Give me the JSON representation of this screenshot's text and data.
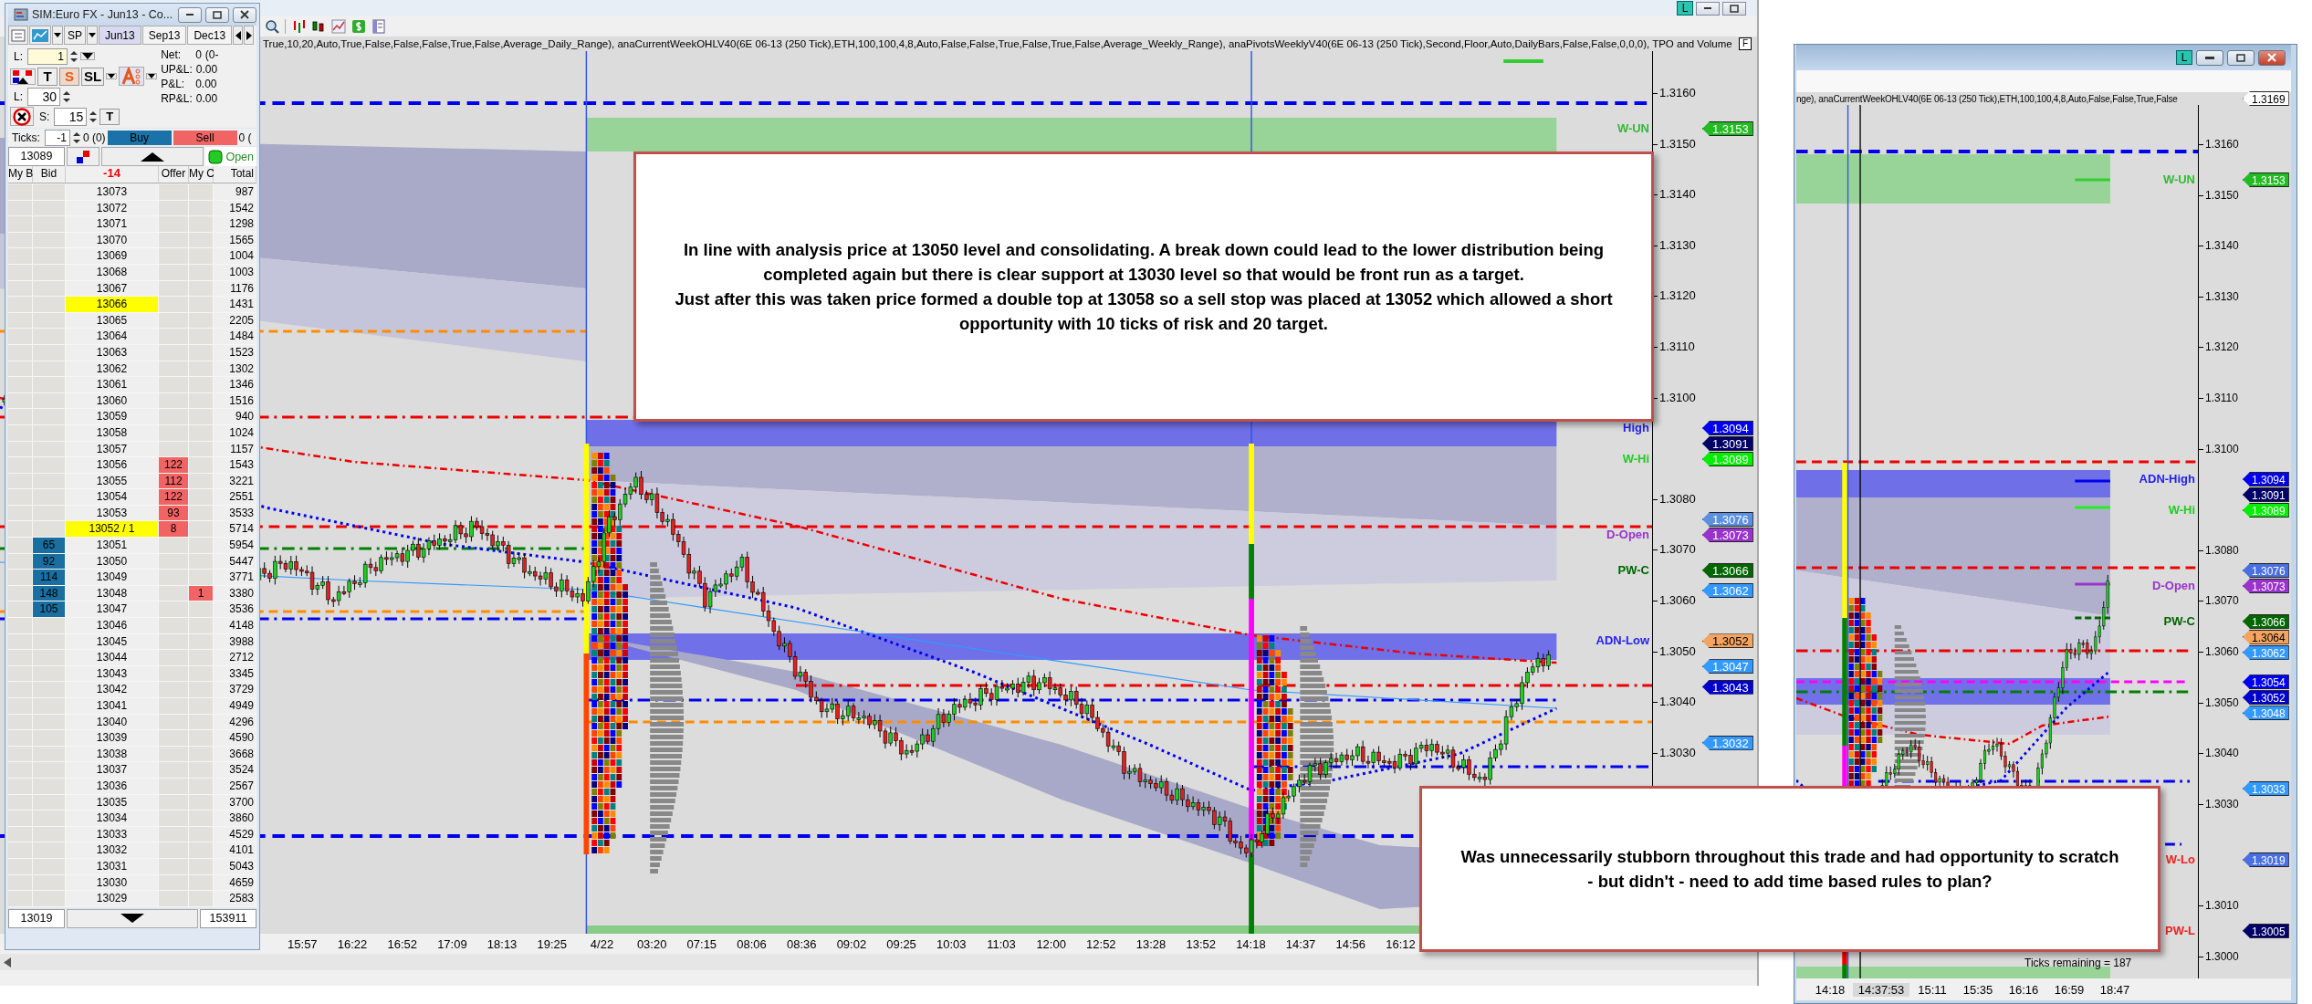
{
  "main_window": {
    "title_buttons": [
      "L"
    ],
    "indicator_text": "True,10,20,Auto,True,False,False,False,True,False,Average_Daily_Range), anaCurrentWeekOHLV40(6E 06-13 (250 Tick),ETH,100,100,4,8,Auto,False,False,True,False,True,False,Average_Weekly_Range), anaPivotsWeeklyV40(6E 06-13 (250 Tick),Second,Floor,Auto,DailyBars,False,False,0,0,0),  TPO and Volume",
    "axis_button": "F",
    "axis_ticks": [
      "1.3160",
      "1.3150",
      "1.3140",
      "1.3130",
      "1.3120",
      "1.3110",
      "1.3100",
      "1.3080",
      "1.3070",
      "1.3060",
      "1.3050",
      "1.3040",
      "1.3030"
    ],
    "price_tags": [
      {
        "label": {
          "text": "W-UN",
          "color": "#33bb33"
        },
        "value": "1.3153",
        "color": "#22bb22"
      },
      {
        "label": {
          "text": "High",
          "color": "#2222ee"
        },
        "value": "1.3094",
        "color": "#0000ee"
      },
      {
        "value": "1.3091",
        "color": "#000066"
      },
      {
        "label": {
          "text": "W-Hi",
          "color": "#22cc22"
        },
        "value": "1.3089",
        "color": "#00ee00"
      },
      {
        "value": "1.3076",
        "color": "#5b8fe0"
      },
      {
        "label": {
          "text": "D-Open",
          "color": "#9933cc"
        },
        "value": "1.3073",
        "color": "#9933cc"
      },
      {
        "label": {
          "text": "PW-C",
          "color": "#006600"
        },
        "value": "1.3066",
        "color": "#006600"
      },
      {
        "value": "1.3062",
        "color": "#3399ff"
      },
      {
        "label": {
          "text": "ADN-Low",
          "color": "#2222ee"
        },
        "value": "1.3052",
        "color": "#f4a460"
      },
      {
        "value": "1.3047",
        "color": "#3399ff"
      },
      {
        "value": "1.3043",
        "color": "#0000cc"
      },
      {
        "value": "1.3032",
        "color": "#3399ff"
      }
    ],
    "time_labels": [
      "15:57",
      "16:22",
      "16:52",
      "17:09",
      "18:13",
      "19:25",
      "4/22",
      "03:20",
      "07:15",
      "08:06",
      "08:36",
      "09:02",
      "09:25",
      "10:03",
      "11:03",
      "12:00",
      "12:52",
      "13:28",
      "13:52",
      "14:18",
      "14:37",
      "14:56",
      "16:12"
    ]
  },
  "dom": {
    "title": "SIM:Euro FX - Jun13 - Co...",
    "instrument": "SP",
    "contracts": [
      {
        "label": "Jun13",
        "selected": true
      },
      {
        "label": "Sep13",
        "selected": false
      },
      {
        "label": "Dec13",
        "selected": false
      }
    ],
    "quantity_label": "L:",
    "quantity": "1",
    "order_buttons": [
      {
        "label": "T",
        "selected": false
      },
      {
        "label": "S",
        "selected": true
      },
      {
        "label": "SL",
        "selected": false
      }
    ],
    "stats": [
      {
        "label": "Net:",
        "value": "0",
        "extra": "(0-"
      },
      {
        "label": "UP&L:",
        "value": "0.00"
      },
      {
        "label": "P&L:",
        "value": "0.00"
      },
      {
        "label": "RP&L:",
        "value": "0.00"
      }
    ],
    "limit_label": "L:",
    "limit": "30",
    "stop_label": "S:",
    "stop": "15",
    "target_button": "T",
    "ticks_label": "Ticks:",
    "ticks": "-1",
    "ticks_count": "0 (0)",
    "buy": "Buy",
    "sell": "Sell",
    "sell_count": "0 (",
    "last_price": "13089",
    "status": "Open",
    "columns": [
      "My B",
      "Bid",
      "-14",
      "Offer",
      "My C",
      "Total"
    ],
    "rows": [
      {
        "price": "13073",
        "total": "987",
        "highlighted": false
      },
      {
        "price": "13072",
        "total": "1542",
        "highlighted": false
      },
      {
        "price": "13071",
        "total": "1298",
        "highlighted": false
      },
      {
        "price": "13070",
        "total": "1565",
        "highlighted": false
      },
      {
        "price": "13069",
        "total": "1004",
        "highlighted": false
      },
      {
        "price": "13068",
        "total": "1003",
        "highlighted": false
      },
      {
        "price": "13067",
        "total": "1176",
        "highlighted": false
      },
      {
        "price": "13066",
        "total": "1431",
        "highlighted": true
      },
      {
        "price": "13065",
        "total": "2205",
        "highlighted": false
      },
      {
        "price": "13064",
        "total": "1484",
        "highlighted": false
      },
      {
        "price": "13063",
        "total": "1523",
        "highlighted": false
      },
      {
        "price": "13062",
        "total": "1302",
        "highlighted": false
      },
      {
        "price": "13061",
        "total": "1346",
        "highlighted": false
      },
      {
        "price": "13060",
        "total": "1516",
        "highlighted": false
      },
      {
        "price": "13059",
        "total": "940",
        "highlighted": false
      },
      {
        "price": "13058",
        "total": "1024",
        "highlighted": false
      },
      {
        "price": "13057",
        "total": "1157",
        "highlighted": false
      },
      {
        "price": "13056",
        "offer": "122",
        "total": "1543",
        "highlighted": false
      },
      {
        "price": "13055",
        "offer": "112",
        "total": "3221",
        "highlighted": false
      },
      {
        "price": "13054",
        "offer": "122",
        "total": "2551",
        "highlighted": false
      },
      {
        "price": "13053",
        "offer": "93",
        "total": "3533",
        "highlighted": false
      },
      {
        "price": "13052 / 1",
        "offer": "8",
        "total": "5714",
        "highlighted": true
      },
      {
        "price": "13051",
        "bid": "65",
        "total": "5954",
        "highlighted": false
      },
      {
        "price": "13050",
        "bid": "92",
        "total": "5447",
        "highlighted": false
      },
      {
        "price": "13049",
        "bid": "114",
        "total": "3771",
        "highlighted": false
      },
      {
        "price": "13048",
        "bid": "148",
        "my_offer": "1",
        "total": "3380",
        "highlighted": false
      },
      {
        "price": "13047",
        "bid": "105",
        "total": "3536",
        "highlighted": false
      },
      {
        "price": "13046",
        "total": "4148",
        "highlighted": false
      },
      {
        "price": "13045",
        "total": "3988",
        "highlighted": false
      },
      {
        "price": "13044",
        "total": "2712",
        "highlighted": false
      },
      {
        "price": "13043",
        "total": "3345",
        "highlighted": false
      },
      {
        "price": "13042",
        "total": "3729",
        "highlighted": false
      },
      {
        "price": "13041",
        "total": "4949",
        "highlighted": false
      },
      {
        "price": "13040",
        "total": "4296",
        "highlighted": false
      },
      {
        "price": "13039",
        "total": "4590",
        "highlighted": false
      },
      {
        "price": "13038",
        "total": "3668",
        "highlighted": false
      },
      {
        "price": "13037",
        "total": "3524",
        "highlighted": false
      },
      {
        "price": "13036",
        "total": "2567",
        "highlighted": false
      },
      {
        "price": "13035",
        "total": "3700",
        "highlighted": false
      },
      {
        "price": "13034",
        "total": "3860",
        "highlighted": false
      },
      {
        "price": "13033",
        "total": "4529",
        "highlighted": false
      },
      {
        "price": "13032",
        "total": "4101",
        "highlighted": false
      },
      {
        "price": "13031",
        "total": "5043",
        "highlighted": false
      },
      {
        "price": "13030",
        "total": "4659",
        "highlighted": false
      },
      {
        "price": "13029",
        "total": "2583",
        "highlighted": false
      }
    ],
    "footer": {
      "low": "13019",
      "volume": "153911"
    }
  },
  "right_window": {
    "title_buttons": [
      "L"
    ],
    "indicator_text": "nge), anaCurrentWeekOHLV40(6E 06-13 (250 Tick),ETH,100,100,4,8,Auto,False,False,True,False",
    "axis_ticks": [
      "1.3160",
      "1.3150",
      "1.3140",
      "1.3130",
      "1.3120",
      "1.3110",
      "1.3100",
      "1.3080",
      "1.3070",
      "1.3060",
      "1.3050",
      "1.3040",
      "1.3030",
      "1.3010",
      "1.3000"
    ],
    "price_tags": [
      {
        "value": "1.3169",
        "color": "#ffffff"
      },
      {
        "label": {
          "text": "W-UN",
          "color": "#33bb33"
        },
        "value": "1.3153",
        "color": "#22bb22"
      },
      {
        "label": {
          "text": "ADN-High",
          "color": "#2222ee"
        },
        "value": "1.3094",
        "color": "#0000ee"
      },
      {
        "value": "1.3091",
        "color": "#000066"
      },
      {
        "label": {
          "text": "W-Hi",
          "color": "#22cc22"
        },
        "value": "1.3089",
        "color": "#00ee00"
      },
      {
        "value": "1.3076",
        "color": "#4a6fe0"
      },
      {
        "label": {
          "text": "D-Open",
          "color": "#9933cc"
        },
        "value": "1.3073",
        "color": "#9933cc"
      },
      {
        "label": {
          "text": "PW-C",
          "color": "#006600"
        },
        "value": "1.3066",
        "color": "#006600"
      },
      {
        "value": "1.3064",
        "color": "#f4a460"
      },
      {
        "value": "1.3062",
        "color": "#3399ff"
      },
      {
        "value": "1.3054",
        "color": "#0000ee"
      },
      {
        "value": "1.3052",
        "color": "#0000cc"
      },
      {
        "value": "1.3048",
        "color": "#3399ff"
      },
      {
        "value": "1.3033",
        "color": "#3399ff"
      },
      {
        "label": {
          "text": "W-Lo",
          "color": "#ee2222"
        },
        "value": "1.3019",
        "color": "#4a6fe0"
      },
      {
        "label": {
          "text": "PW-L",
          "color": "#ee2222"
        },
        "value": "1.3005",
        "color": "#000066"
      }
    ],
    "ticks_remaining": "Ticks remaining = 187",
    "time_labels": [
      {
        "text": "14:18",
        "highlighted": false
      },
      {
        "text": "14:37:53",
        "highlighted": true
      },
      {
        "text": "15:11",
        "highlighted": false
      },
      {
        "text": "15:35",
        "highlighted": false
      },
      {
        "text": "16:16",
        "highlighted": false
      },
      {
        "text": "16:59",
        "highlighted": false
      },
      {
        "text": "18:47",
        "highlighted": false
      }
    ]
  },
  "annotations": [
    {
      "paragraphs": [
        "In line with analysis price at 13050 level and consolidating. A break down could lead to the lower distribution being completed again but there is clear support at 13030 level so that would be front run as a target.",
        "Just after this was taken price formed a double top at 13058 so a sell stop was placed at 13052 which allowed a short opportunity with 10 ticks of risk and 20 target."
      ]
    },
    {
      "paragraphs": [
        "Was unnecessarily stubborn throughout this trade and had opportunity to scratch - but didn't - need to add time based rules to plan?"
      ]
    }
  ]
}
